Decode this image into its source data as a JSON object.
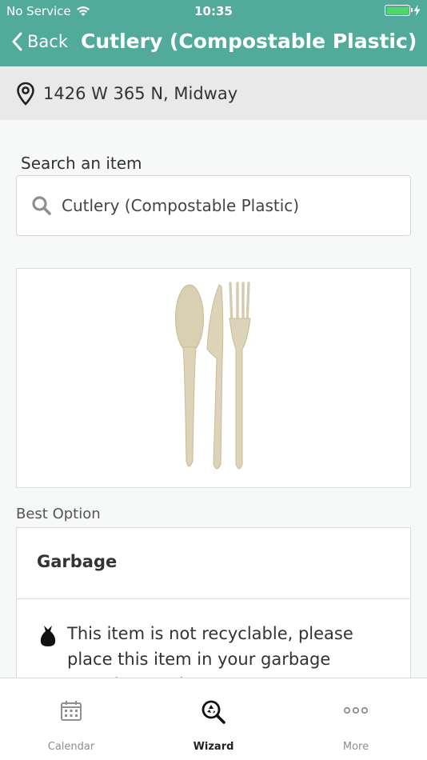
{
  "status": {
    "carrier": "No Service",
    "time": "10:35",
    "battery_color": "#4cd964"
  },
  "nav": {
    "back_label": "Back",
    "title": "Cutlery (Compostable Plastic)",
    "bar_color": "#52ab9a"
  },
  "address": {
    "icon": "location-pin-icon",
    "text": "1426 W 365 N, Midway"
  },
  "search": {
    "label": "Search an item",
    "icon": "search-icon",
    "value": "Cutlery (Compostable Plastic)"
  },
  "item_image": {
    "icon": "cutlery-image"
  },
  "best_option": {
    "label": "Best Option",
    "title": "Garbage",
    "icon": "garbage-bag-icon",
    "description": "This item is not recyclable, please place this item in your garbage container and ..."
  },
  "tabs": [
    {
      "label": "Calendar",
      "icon": "calendar-icon",
      "active": false
    },
    {
      "label": "Wizard",
      "icon": "wizard-search-icon",
      "active": true
    },
    {
      "label": "More",
      "icon": "more-icon",
      "active": false
    }
  ]
}
